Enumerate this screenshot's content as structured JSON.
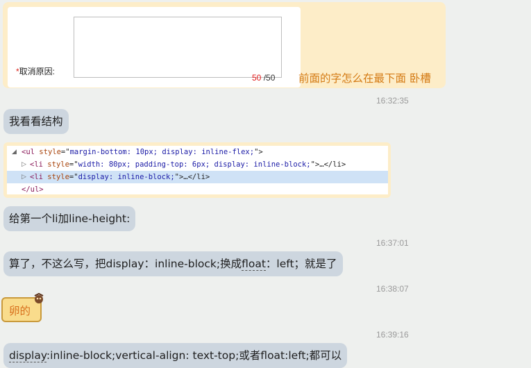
{
  "messages": {
    "m1": {
      "form": {
        "required_mark": "*",
        "label": "取消原因:",
        "counter_current": "50",
        "counter_max": " /50"
      },
      "text": "前面的字怎么在最下面 卧槽"
    },
    "t1": "16:32:35",
    "m2": "我看看结构",
    "m3": {
      "lines": [
        {
          "tri": "◢",
          "open": "<ul ",
          "attr": "style",
          "eq": "=\"",
          "val": "margin-bottom: 10px; display: inline-flex;",
          "close": "\">"
        },
        {
          "tri": "▷",
          "open": "<li ",
          "attr": "style",
          "eq": "=\"",
          "val": "width: 80px; padding-top: 6px; display: inline-block;",
          "close": "\">…</li>"
        },
        {
          "tri": "▷",
          "open": "<li ",
          "attr": "style",
          "eq": "=\"",
          "val": "display: inline-block;",
          "close": "\">…</li>"
        },
        {
          "tri": "",
          "open": "</ul>",
          "attr": "",
          "eq": "",
          "val": "",
          "close": ""
        }
      ]
    },
    "m4": "给第一个li加line-height:",
    "t2": "16:37:01",
    "m5": {
      "before": "算了，不这么写，把display：inline-block;换成",
      "underlined": "float",
      "after": "：left；就是了"
    },
    "t3": "16:38:07",
    "m6": "卵的",
    "t4": "16:39:16",
    "m7": {
      "underlined": "display",
      "after": ":inline-block;vertical-align: text-top;或者float:left;都可以"
    }
  },
  "colors": {
    "own_bubble": "#fdedc8",
    "other_bubble": "#cdd6df",
    "accent_text": "#d47a13"
  }
}
